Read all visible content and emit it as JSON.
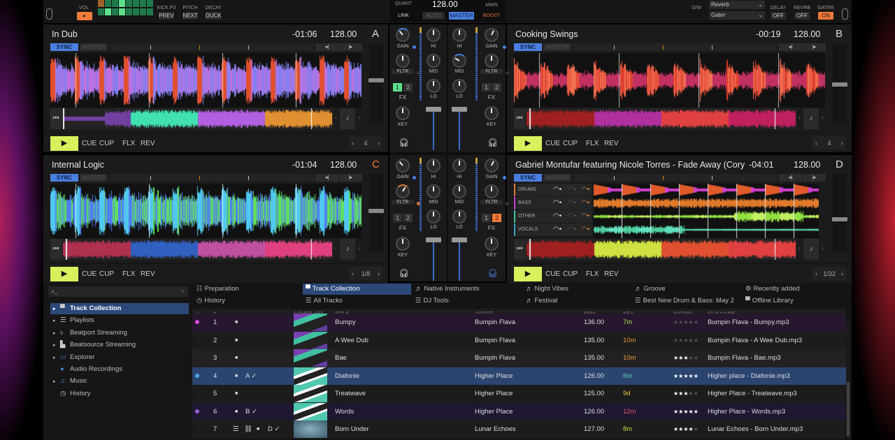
{
  "top": {
    "vol": "VOL",
    "kick": "KICK P3",
    "pitch": "PITCH",
    "decay": "DECAY",
    "prev": "PREV",
    "next": "NEXT",
    "duck": "DUCK",
    "quant": "QUANT",
    "tempo": "128.00",
    "main": "MAIN",
    "link": "LINK",
    "auto": "AUTO",
    "master": "MASTER",
    "boost": "BOOST",
    "dw": "D/W",
    "fx1": "Reverb",
    "fx2": "Gater",
    "delay": "DELAY",
    "revrb": "REVRB",
    "gater": "GATER",
    "delay_state": "OFF",
    "revrb_state": "OFF",
    "gater_state": "ON",
    "accent_orange": "#f07a3a",
    "accent_blue": "#4a7fe0"
  },
  "decks": [
    {
      "id": "A",
      "title": "In Dub",
      "time": "-01:06",
      "bpm": "128.00",
      "letter": "A",
      "letter_color": "#dddddd",
      "loop": "4",
      "style": "blob",
      "sync": "SYNC",
      "master": "MASTER"
    },
    {
      "id": "B",
      "title": "Cooking Swings",
      "time": "-00:19",
      "bpm": "128.00",
      "letter": "B",
      "letter_color": "#dddddd",
      "loop": "4",
      "style": "red",
      "sync": "SYNC",
      "master": "MASTER"
    },
    {
      "id": "C",
      "title": "Internal Logic",
      "time": "-01:04",
      "bpm": "128.00",
      "letter": "C",
      "letter_color": "#f07a3a",
      "loop": "1/8",
      "style": "blob",
      "sync": "SYNC",
      "master": "MASTER"
    },
    {
      "id": "D",
      "title": "Gabriel Montufar featuring Nicole Torres - Fade Away (Cory Gr",
      "time": "-04:01",
      "bpm": "128.00",
      "letter": "D",
      "letter_color": "#dddddd",
      "loop": "1/32",
      "style": "stems",
      "sync": "SYNC",
      "master": "MASTER",
      "stems": [
        "DRUMS",
        "BASS",
        "OTHER",
        "VOCALS"
      ]
    }
  ],
  "transport": {
    "play": "▶",
    "cue": "CUE",
    "cup": "CUP",
    "flx": "FLX",
    "rev": "REV"
  },
  "mixer": {
    "gain": "GAIN",
    "fltr": "FLTR",
    "fx": "FX",
    "key": "KEY",
    "hi": "HI",
    "mid": "MID",
    "lo": "LO",
    "fx1": "1",
    "fx2": "2",
    "channels": [
      {
        "id": "A",
        "fx_active": "1"
      },
      {
        "id": "B",
        "fx_active": ""
      },
      {
        "id": "C",
        "fx_active": "",
        "fltr_on": true
      },
      {
        "id": "D",
        "fx_active": "2",
        "cue_on": true
      }
    ]
  },
  "browser": {
    "search_placeholder": "",
    "tree": [
      {
        "label": "Track Collection",
        "selected": true,
        "icon": "collection-icon"
      },
      {
        "label": "Playlists",
        "icon": "playlist-icon"
      },
      {
        "label": "Beatport Streaming",
        "icon": "beatport-icon"
      },
      {
        "label": "Beatsource Streaming",
        "icon": "beatsource-icon"
      },
      {
        "label": "Explorer",
        "icon": "explorer-icon"
      },
      {
        "label": "Audio Recordings",
        "icon": "recordings-icon"
      },
      {
        "label": "Music",
        "icon": "music-icon"
      },
      {
        "label": "History",
        "icon": "history-icon"
      }
    ],
    "favorites": [
      [
        "Preparation",
        "History"
      ],
      [
        "Track Collection",
        "All Tracks"
      ],
      [
        "Native Instruments",
        "DJ Tools"
      ],
      [
        "Night Vibes",
        "Festival"
      ],
      [
        "Groove",
        "Best New Drum & Bass: May 2"
      ],
      [
        "Recently added",
        "Offline Library"
      ]
    ],
    "columns": [
      "#",
      "COVER ART",
      "TITLE",
      "ARTIST",
      "BPM",
      "KEY",
      "RATING",
      "FILE NAME"
    ],
    "rows": [
      {
        "n": "1",
        "flags": "",
        "title": "Bumpy",
        "artist": "Bumpin Flava",
        "bpm": "136.00",
        "key": "7m",
        "key_color": "#a8e05a",
        "rating": 0,
        "file": "Bumpin Flava - Bumpy.mp3",
        "dot": "#d050e0",
        "bg": "#26172e"
      },
      {
        "n": "2",
        "flags": "",
        "title": "A Wee Dub",
        "artist": "Bumpin Flava",
        "bpm": "135.00",
        "key": "10m",
        "key_color": "#e89a3c",
        "rating": 0,
        "file": "Bumpin Flava - A Wee Dub.mp3",
        "dot": "",
        "bg": "#1c1c1c"
      },
      {
        "n": "3",
        "flags": "",
        "title": "Bae",
        "artist": "Bumpin Flava",
        "bpm": "135.00",
        "key": "10m",
        "key_color": "#e89a3c",
        "rating": 3,
        "file": "Bumpin Flava - Bae.mp3",
        "dot": "",
        "bg": "#222222"
      },
      {
        "n": "4",
        "flags": "A ✓",
        "title": "Diafonie",
        "artist": "Higher Place",
        "bpm": "126.00",
        "key": "6m",
        "key_color": "#5fd0b0",
        "rating": 5,
        "file": "Higher place - Diafonie.mp3",
        "dot": "#4aa8e8",
        "bg": "#2b4570"
      },
      {
        "n": "5",
        "flags": "",
        "title": "Treatwave",
        "artist": "Higher Place",
        "bpm": "125.00",
        "key": "9d",
        "key_color": "#e8c83a",
        "rating": 3,
        "file": "Higher Place - Treatwave.mp3",
        "dot": "",
        "bg": "#1c1c1c"
      },
      {
        "n": "6",
        "flags": "B ✓",
        "title": "Words",
        "artist": "Higher Place",
        "bpm": "126.00",
        "key": "12m",
        "key_color": "#e0566a",
        "rating": 5,
        "file": "Higher Place - Words.mp3",
        "dot": "#9a60e0",
        "bg": "#1f1830"
      },
      {
        "n": "7",
        "flags": "D ✓",
        "title": "Born Under",
        "artist": "Lunar Echoes",
        "bpm": "127.00",
        "key": "8m",
        "key_color": "#c8e050",
        "rating": 4,
        "file": "Lunar Echoes - Born Under.mp3",
        "dot": "",
        "bg": "#1c1c1c",
        "extra_icons": true
      }
    ]
  }
}
